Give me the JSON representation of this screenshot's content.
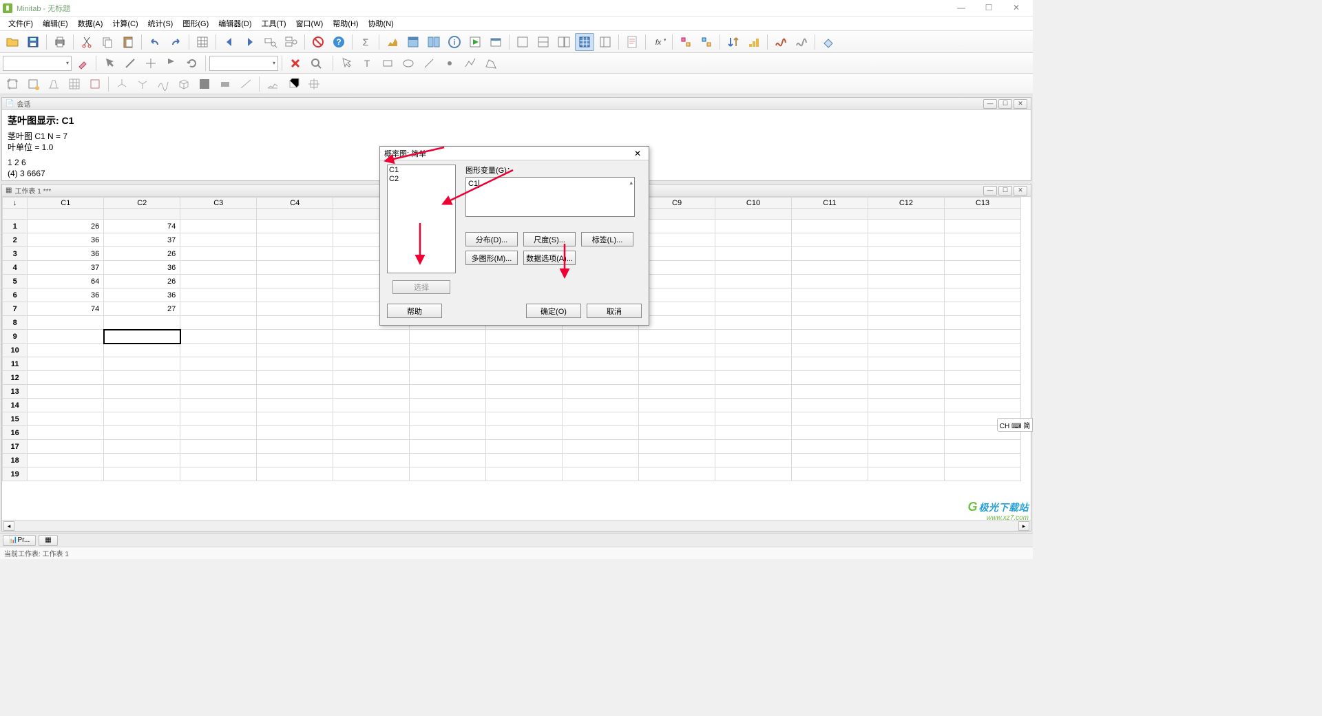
{
  "titlebar": {
    "app": "Minitab",
    "doc": "无标题"
  },
  "menu": [
    "文件(F)",
    "编辑(E)",
    "数据(A)",
    "计算(C)",
    "统计(S)",
    "图形(G)",
    "编辑器(D)",
    "工具(T)",
    "窗口(W)",
    "帮助(H)",
    "协助(N)"
  ],
  "session": {
    "tab": "会话",
    "heading": "茎叶图显示: C1",
    "line1": "茎叶图 C1  N  = 7",
    "line2": "叶单位 = 1.0",
    "line3": " 1   2  6",
    "line4": "(4)  3  6667"
  },
  "worksheet": {
    "tab": "工作表 1 ***",
    "cols": [
      "C1",
      "C2",
      "C3",
      "C4",
      "",
      "",
      "",
      "",
      "C9",
      "C10",
      "C11",
      "C12",
      "C13"
    ],
    "rows": [
      [
        "26",
        "74"
      ],
      [
        "36",
        "37"
      ],
      [
        "36",
        "26"
      ],
      [
        "37",
        "36"
      ],
      [
        "64",
        "26"
      ],
      [
        "36",
        "36"
      ],
      [
        "74",
        "27"
      ]
    ],
    "row_count": 19,
    "current_cell": {
      "row": 9,
      "col": 2
    }
  },
  "dialog": {
    "title": "概率图: 简单",
    "list": [
      "C1",
      "C2"
    ],
    "vars_label": "图形变量(G)：",
    "vars_value": "C1",
    "btns": {
      "dist": "分布(D)...",
      "scale": "尺度(S)...",
      "labels": "标签(L)...",
      "multi": "多图形(M)...",
      "dataopt": "数据选项(A)...",
      "select": "选择",
      "help": "帮助",
      "ok": "确定(O)",
      "cancel": "取消"
    }
  },
  "taskbar": {
    "t1": "Pr...",
    "t2": ""
  },
  "status": "当前工作表: 工作表 1",
  "ime": "CH ⌨ 简",
  "watermark": {
    "l1": "极光下载站",
    "l2": "www.xz7.com"
  }
}
